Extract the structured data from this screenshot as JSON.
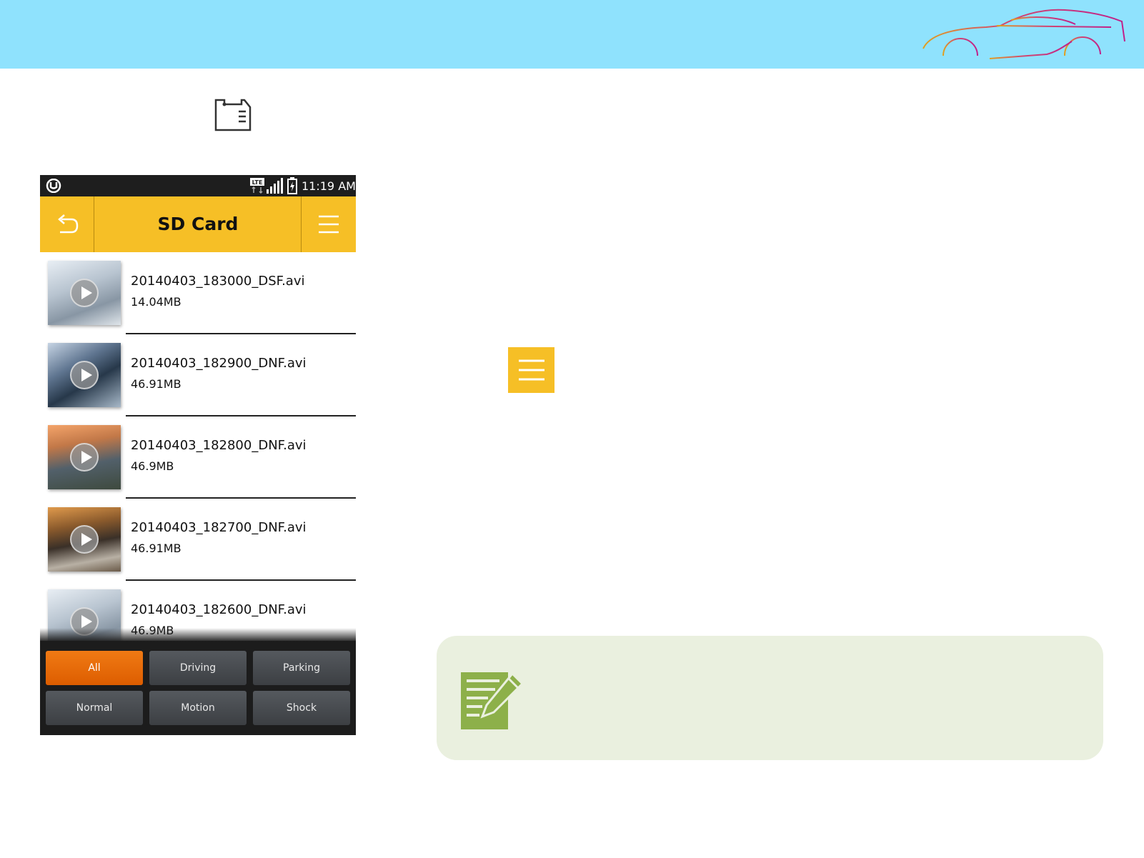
{
  "banner": {
    "logo_icon": "sports-car-outline-icon",
    "color": "#8fe2fd"
  },
  "sd_card_icon": "sd-card-icon",
  "phone": {
    "status_bar": {
      "time": "11:19 AM",
      "network": "LTE",
      "icons": [
        "app-logo-icon",
        "lte-icon",
        "signal-icon",
        "battery-icon"
      ]
    },
    "header": {
      "title": "SD Card",
      "back_icon": "back-arrow-icon",
      "menu_icon": "hamburger-menu-icon",
      "color": "#f6bf26"
    },
    "files": [
      {
        "name": "20140403_183000_DSF.avi",
        "size": "14.04MB"
      },
      {
        "name": "20140403_182900_DNF.avi",
        "size": "46.91MB"
      },
      {
        "name": "20140403_182800_DNF.avi",
        "size": "46.9MB"
      },
      {
        "name": "20140403_182700_DNF.avi",
        "size": "46.91MB"
      },
      {
        "name": "20140403_182600_DNF.avi",
        "size": "46.9MB"
      }
    ],
    "filters": [
      {
        "label": "All",
        "active": true
      },
      {
        "label": "Driving",
        "active": false
      },
      {
        "label": "Parking",
        "active": false
      },
      {
        "label": "Normal",
        "active": false
      },
      {
        "label": "Motion",
        "active": false
      },
      {
        "label": "Shock",
        "active": false
      }
    ],
    "active_filter_color": "#e8690a"
  },
  "menu_icon_large": "hamburger-menu-icon",
  "note": {
    "icon": "note-pencil-icon",
    "color": "#eaf0df",
    "icon_color": "#8db04a"
  }
}
